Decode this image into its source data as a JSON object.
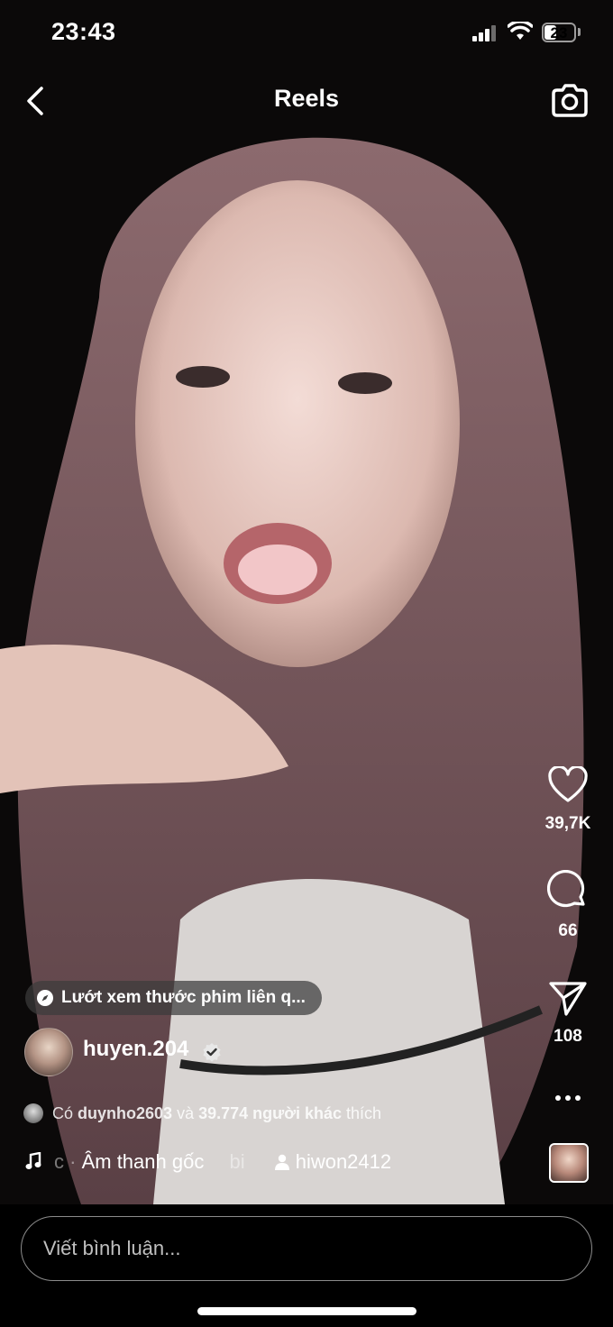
{
  "status_bar": {
    "time": "23:43",
    "battery": "23",
    "icons": [
      "cellular-signal-icon",
      "wifi-icon",
      "battery-icon"
    ]
  },
  "header": {
    "title": "Reels",
    "back_icon": "chevron-left-icon",
    "camera_icon": "camera-icon"
  },
  "actions": {
    "like_count": "39,7K",
    "comment_count": "66",
    "share_count": "108",
    "more_icon": "ellipsis-icon"
  },
  "related": {
    "label": "Lướt xem thước phim liên q..."
  },
  "author": {
    "username": "huyen.204",
    "verified": true
  },
  "likes": {
    "prefix": "Có",
    "user": "duynho2603",
    "joiner": "và",
    "others": "39.774 người khác",
    "suffix": "thích"
  },
  "audio": {
    "fade_left": "c ·",
    "title": "Âm thanh gốc",
    "fade_right": "bi",
    "tagged_user": "hiwon2412"
  },
  "comment_box": {
    "placeholder": "Viết bình luận..."
  },
  "colors": {
    "background": "#000000",
    "text": "#ffffff",
    "pill": "#3c3c3c"
  }
}
